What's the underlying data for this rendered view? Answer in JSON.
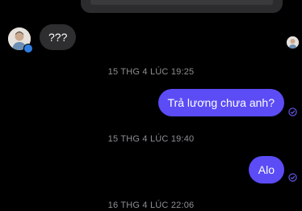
{
  "colors": {
    "background": "#000000",
    "incoming_bubble": "#2e2e30",
    "outgoing_bubble": "#5b4cf5",
    "timestamp": "#8e8e93",
    "sent_check": "#6b5cf7"
  },
  "messages": [
    {
      "direction": "incoming",
      "text": "???"
    },
    {
      "direction": "outgoing",
      "text": "Trả lương chưa anh?"
    },
    {
      "direction": "outgoing",
      "text": "Alo"
    }
  ],
  "timestamps": [
    "15 THG 4 LÚC 19:25",
    "15 THG 4 LÚC 19:40",
    "16 THG 4 LÚC 22:06"
  ],
  "icons": {
    "contact_avatar": "avatar",
    "seen_indicator": "seen-avatar-icon",
    "sent_status": "check-circle-icon"
  }
}
